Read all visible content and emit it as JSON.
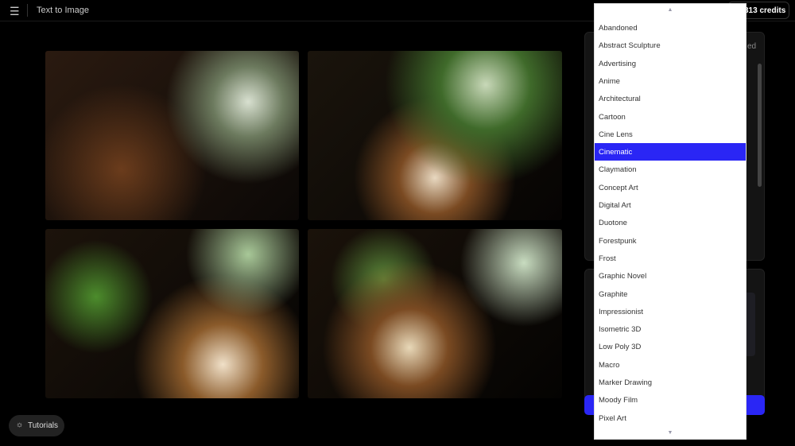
{
  "header": {
    "menu_icon": "hamburger-icon",
    "title": "Text to Image",
    "credits": "313 credits"
  },
  "panel": {
    "partial_text": "ed"
  },
  "tutorials": {
    "label": "Tutorials",
    "icon": "lightbulb-icon"
  },
  "dropdown": {
    "selected": "Cinematic",
    "options": [
      "Abandoned",
      "Abstract Sculpture",
      "Advertising",
      "Anime",
      "Architectural",
      "Cartoon",
      "Cine Lens",
      "Cinematic",
      "Claymation",
      "Concept Art",
      "Digital Art",
      "Duotone",
      "Forestpunk",
      "Frost",
      "Graphic Novel",
      "Graphite",
      "Impressionist",
      "Isometric 3D",
      "Low Poly 3D",
      "Macro",
      "Marker Drawing",
      "Moody Film",
      "Pixel Art"
    ]
  },
  "colors": {
    "accent": "#2a26f5",
    "background": "#000000"
  }
}
